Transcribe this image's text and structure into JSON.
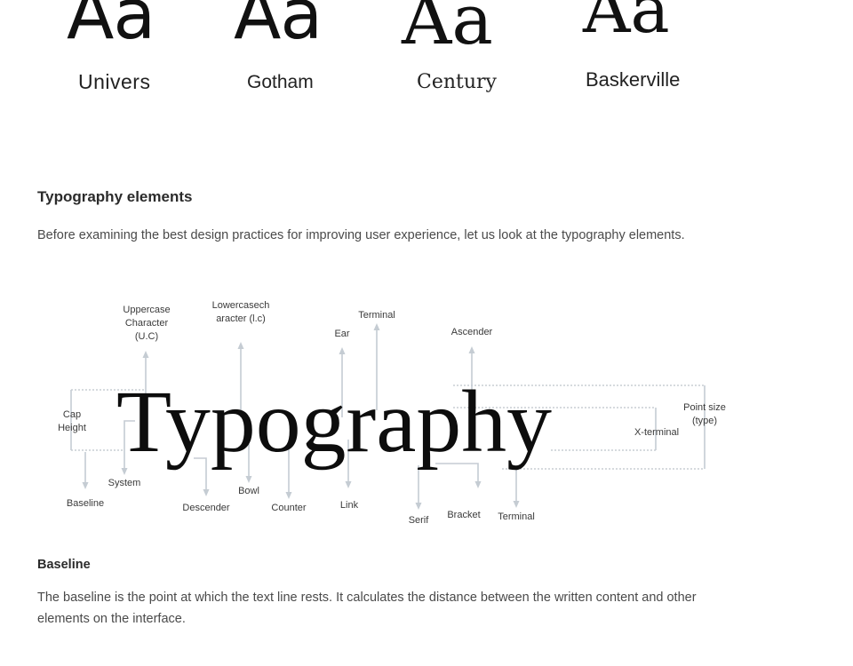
{
  "specimens": [
    {
      "glyph": "Aa",
      "name": "Univers"
    },
    {
      "glyph": "Aa",
      "name": "Gotham"
    },
    {
      "glyph": "Aa",
      "name": "Century"
    },
    {
      "glyph": "Aa",
      "name": "Baskerville"
    }
  ],
  "section": {
    "heading": "Typography elements",
    "intro": "Before examining the best design practices for improving user experience, let us look at the typography elements."
  },
  "diagram": {
    "word": "Typography",
    "labels": {
      "uppercase_1": "Uppercase",
      "uppercase_2": "Character",
      "uppercase_3": "(U.C)",
      "lowercase_1": "Lowercasech",
      "lowercase_2": "aracter (l.c)",
      "ear": "Ear",
      "terminal_top": "Terminal",
      "ascender": "Ascender",
      "cap_height_1": "Cap",
      "cap_height_2": "Height",
      "x_terminal": "X-terminal",
      "point_size_1": "Point size",
      "point_size_2": "(type)",
      "system": "System",
      "baseline": "Baseline",
      "descender": "Descender",
      "bowl": "Bowl",
      "counter": "Counter",
      "link": "Link",
      "serif": "Serif",
      "bracket": "Bracket",
      "terminal_bottom": "Terminal"
    }
  },
  "baseline_section": {
    "heading": "Baseline",
    "text": "The baseline is the point at which the text line rests. It calculates the distance between the written content and other elements on the interface."
  }
}
